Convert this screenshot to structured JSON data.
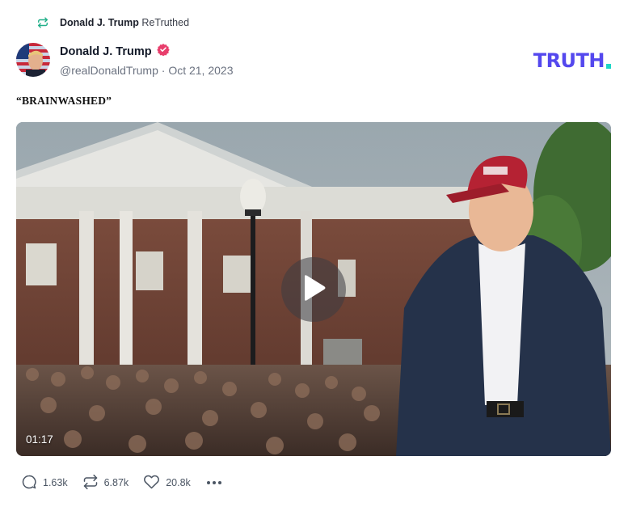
{
  "retruth": {
    "icon": "retruth-icon",
    "name": "Donald J. Trump",
    "suffix": "ReTruthed"
  },
  "post": {
    "author": {
      "display_name": "Donald J. Trump",
      "verified": true,
      "badge_color": "#e83e6c",
      "handle": "@realDonaldTrump",
      "separator": "·",
      "date": "Oct 21, 2023"
    },
    "text": "“BRAINWASHED”",
    "media": {
      "type": "video",
      "duration": "01:17",
      "play_icon": "play-icon"
    },
    "actions": {
      "replies": "1.63k",
      "retruths": "6.87k",
      "likes": "20.8k",
      "more_icon": "ellipsis-icon"
    }
  },
  "brand": {
    "logo_text": "TRUTH",
    "color": "#5448ee",
    "dot_color": "#1fd6c6"
  }
}
